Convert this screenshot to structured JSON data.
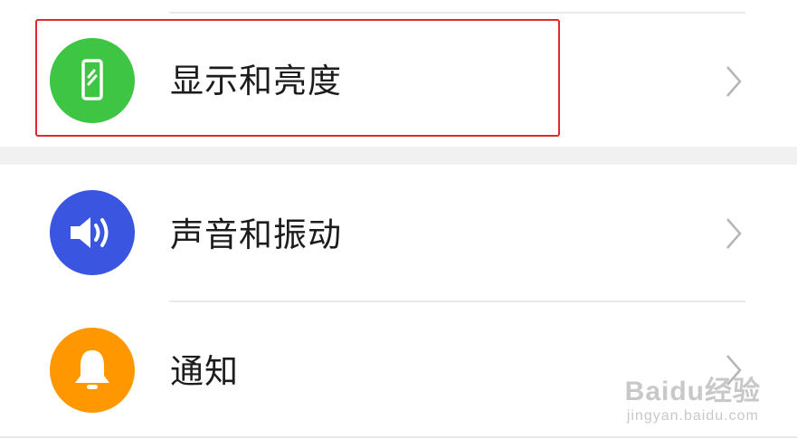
{
  "settings": {
    "items": [
      {
        "label": "显示和亮度",
        "icon": "phone-screen-icon",
        "color": "#3ec543"
      },
      {
        "label": "声音和振动",
        "icon": "speaker-icon",
        "color": "#3a55e0"
      },
      {
        "label": "通知",
        "icon": "bell-icon",
        "color": "#ff9800"
      }
    ]
  },
  "highlight_color": "#e0282e",
  "watermark": {
    "main": "Baidu经验",
    "sub": "jingyan.baidu.com"
  }
}
